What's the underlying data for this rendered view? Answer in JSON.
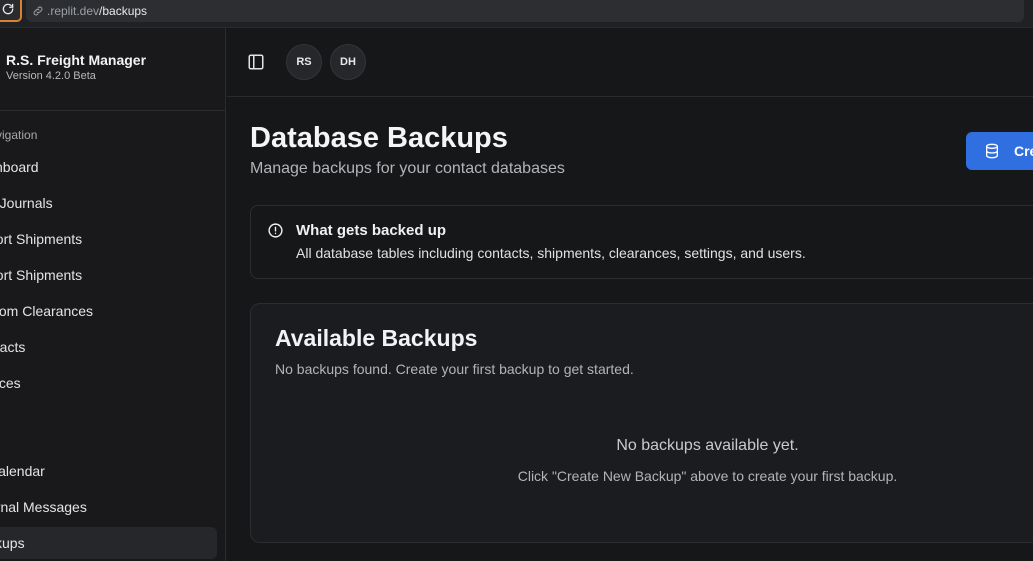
{
  "browser": {
    "url_host": ".replit.dev",
    "url_path": "/backups"
  },
  "sidebar": {
    "app_name": "R.S. Freight Manager",
    "version": "Version 4.2.0 Beta",
    "nav_heading": "vigation",
    "items": [
      {
        "label": "shboard"
      },
      {
        "label": "o Journals"
      },
      {
        "label": "port Shipments"
      },
      {
        "label": "port Shipments"
      },
      {
        "label": "stom Clearances"
      },
      {
        "label": "ntacts"
      },
      {
        "label": "oices"
      },
      {
        "label": " Calendar"
      },
      {
        "label": "ernal Messages"
      },
      {
        "label": "ckups"
      }
    ]
  },
  "header": {
    "avatars": [
      "RS",
      "DH"
    ]
  },
  "main": {
    "title": "Database Backups",
    "subtitle": "Manage backups for your contact databases",
    "create_button_label": "Cre",
    "info": {
      "title": "What gets backed up",
      "text": "All database tables including contacts, shipments, clearances, settings, and users."
    },
    "backups": {
      "title": "Available Backups",
      "description": "No backups found. Create your first backup to get started.",
      "empty_title": "No backups available yet.",
      "empty_hint": "Click \"Create New Backup\" above to create your first backup."
    }
  },
  "colors": {
    "accent": "#2f6fe0",
    "background": "#161719",
    "card": "#1b1c1f",
    "focus_ring": "#d9822b"
  }
}
